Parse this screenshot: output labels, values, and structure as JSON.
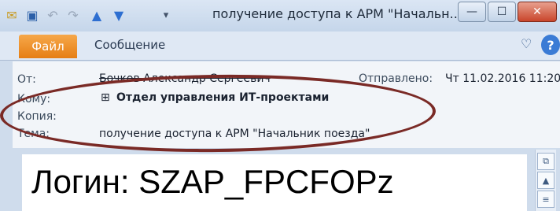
{
  "titlebar": {
    "title": "получение доступа к АРМ \"Начальн...",
    "minimize": "—",
    "maximize": "☐",
    "close": "✕"
  },
  "quick_access": {
    "mail_icon": "envelope-icon",
    "save_icon": "save-icon",
    "undo_icon": "undo-icon",
    "redo_icon": "redo-icon",
    "up_icon": "up-arrow-icon",
    "down_icon": "down-arrow-icon",
    "customize_icon": "customize-icon"
  },
  "ribbon": {
    "file_tab": "Файл",
    "message_tab": "Сообщение",
    "expand_glyph": "♡",
    "help_glyph": "?"
  },
  "header": {
    "from_label": "От:",
    "from_value": "Бочков Александр Сергеевич",
    "sent_label": "Отправлено:",
    "sent_value": "Чт 11.02.2016 11:20",
    "to_label": "Кому:",
    "to_value": "Отдел управления ИТ-проектами",
    "expand_glyph": "⊞",
    "cc_label": "Копия:",
    "subject_label": "Тема:",
    "subject_value": "получение доступа к АРМ \"Начальник поезда\""
  },
  "body": {
    "text": "Логин: SZAP_FPCFOPz"
  },
  "colors": {
    "file_tab": "#e67e14",
    "annotation": "#7a2a26",
    "close_button": "#c9452b"
  }
}
